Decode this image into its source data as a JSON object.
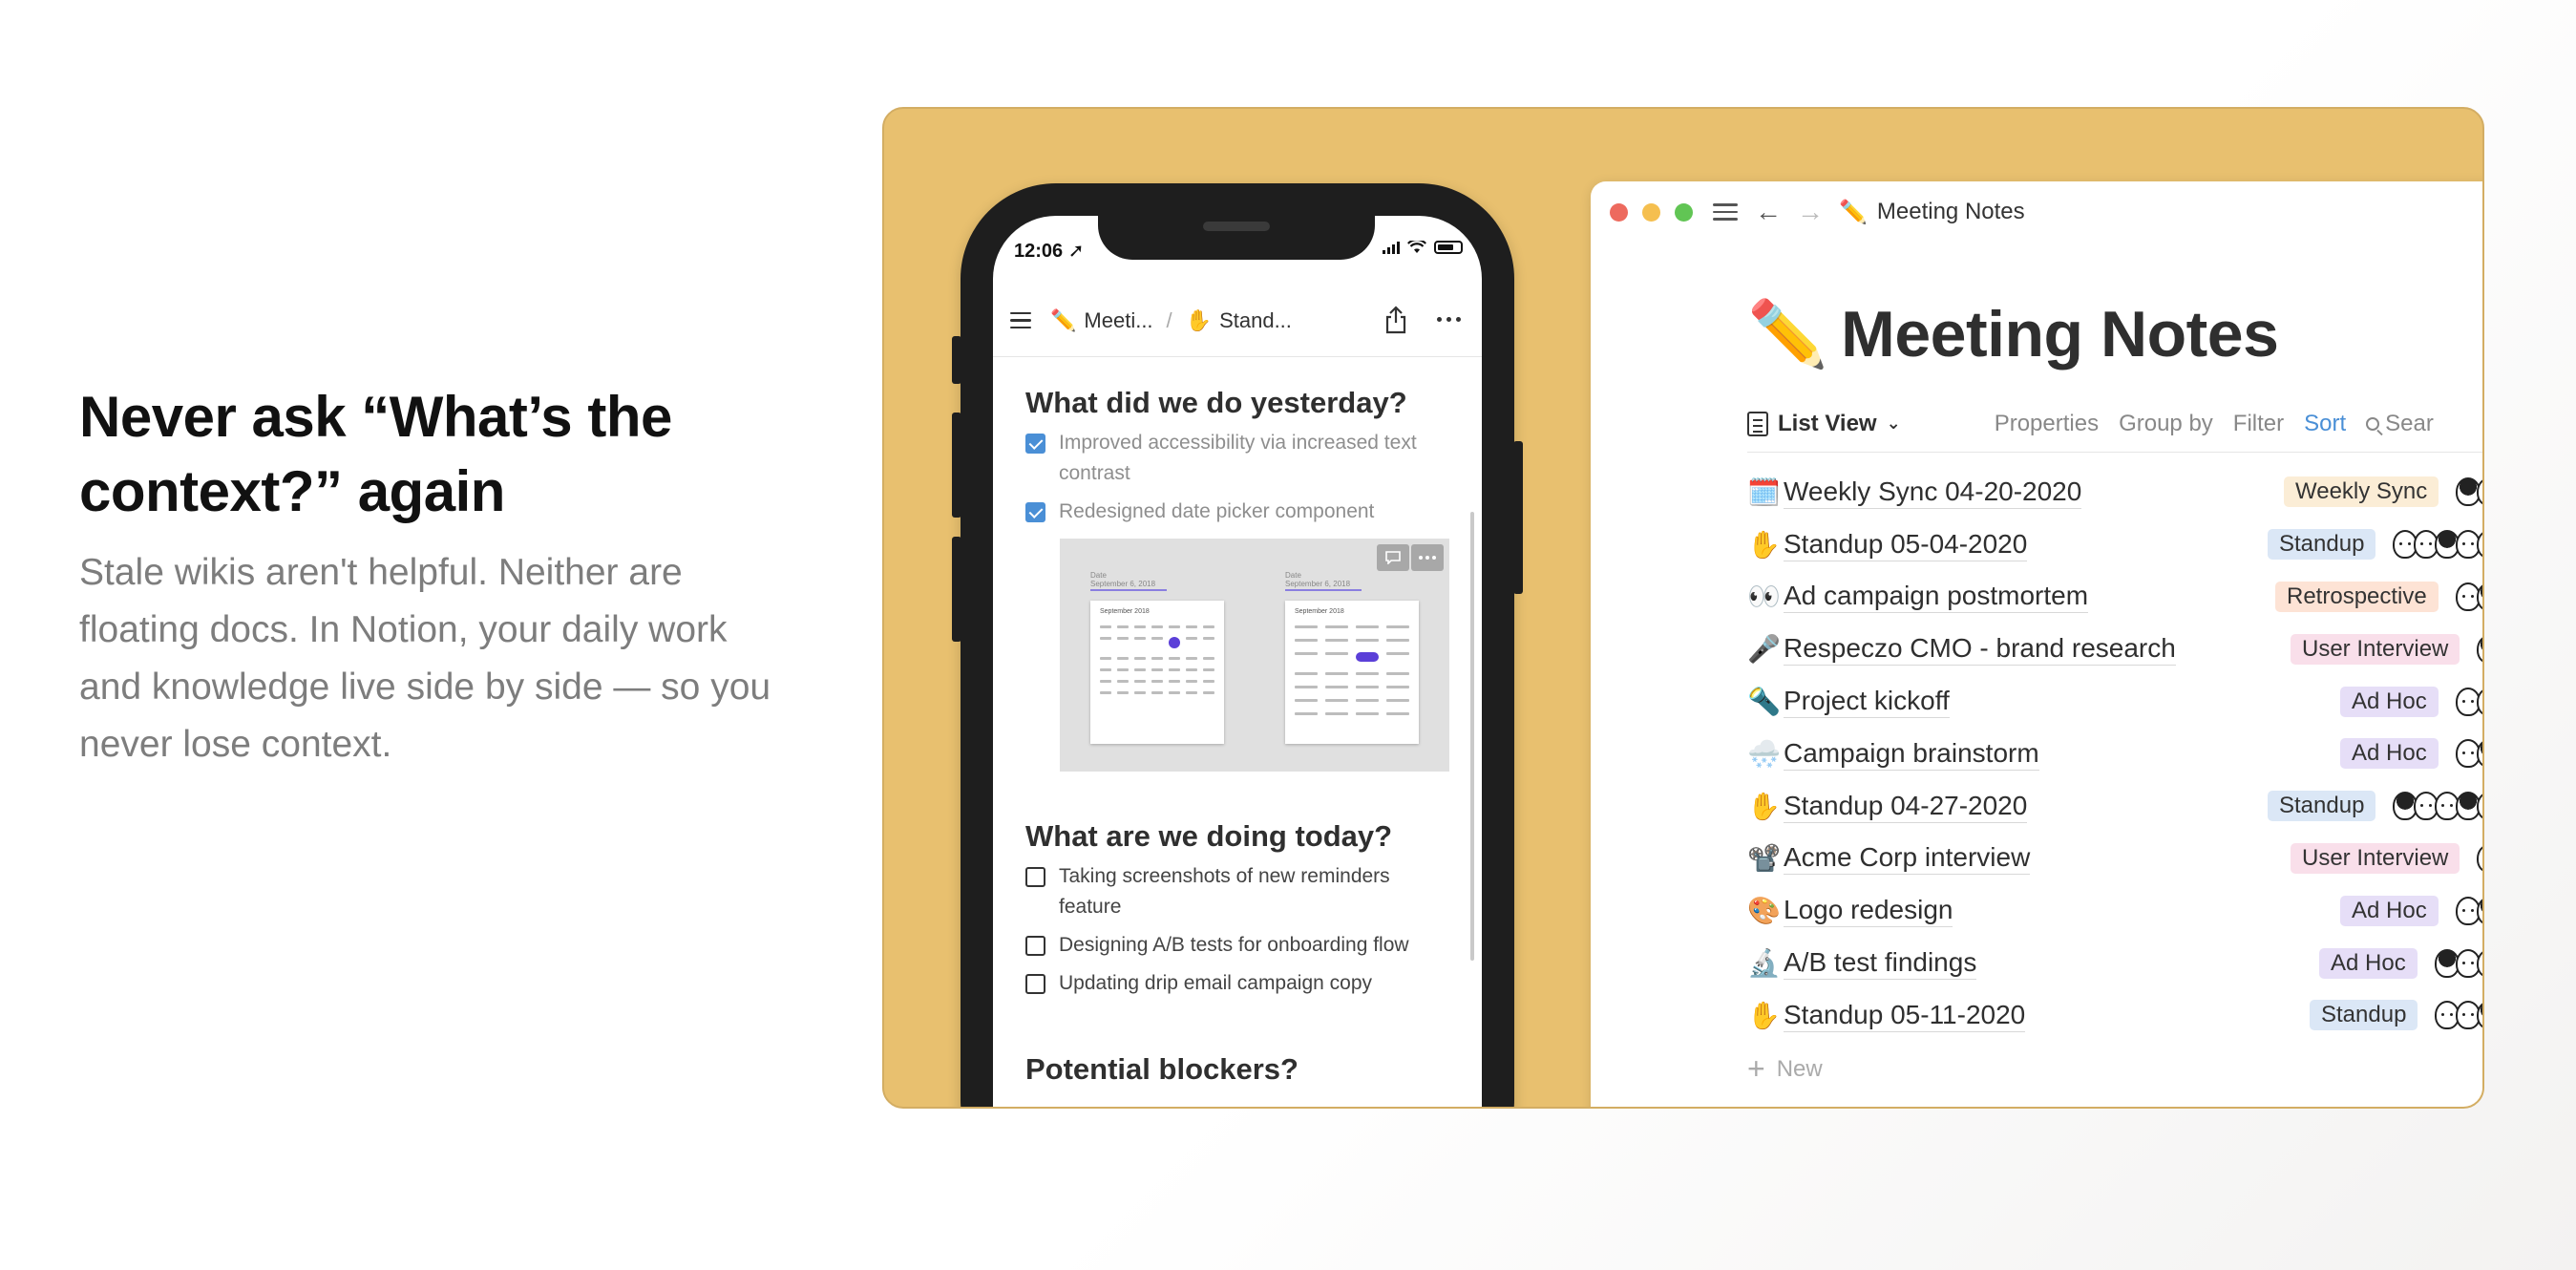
{
  "hero": {
    "heading": "Never ask “What’s the context?” again",
    "body": "Stale wikis aren't helpful. Neither are floating docs. In Notion, your daily work and knowledge live side by side — so you never lose context."
  },
  "colors": {
    "stage": "#e8c06f",
    "accent_blue": "#4a8fd6",
    "tag_weekly_sync": "#fbedd6",
    "tag_standup": "#dbe7f6",
    "tag_retrospective": "#fde3d5",
    "tag_user_interview": "#f9dfea",
    "tag_ad_hoc": "#e6def7"
  },
  "phone": {
    "time": "12:06",
    "breadcrumb": [
      {
        "icon": "✏️",
        "label": "Meeti..."
      },
      {
        "icon": "✋",
        "label": "Stand..."
      }
    ],
    "separator": "/",
    "sections": {
      "yesterday": {
        "heading": "What did we do yesterday?",
        "items": [
          {
            "text": "Improved accessibility via increased text contrast",
            "checked": true
          },
          {
            "text": "Redesigned date picker component",
            "checked": true
          }
        ]
      },
      "today": {
        "heading": "What are we doing today?",
        "items": [
          {
            "text": "Taking screenshots of new reminders feature",
            "checked": false
          },
          {
            "text": "Designing A/B tests for onboarding flow",
            "checked": false
          },
          {
            "text": "Updating drip email campaign copy",
            "checked": false
          }
        ]
      },
      "blockers": {
        "heading": "Potential blockers?"
      }
    },
    "embed": {
      "left_label": "Date",
      "left_value": "September 6, 2018",
      "right_label": "Date",
      "right_value": "September 6, 2018",
      "left_month": "September 2018",
      "right_month": "September 2018"
    }
  },
  "window": {
    "title_icon": "✏️",
    "title": "Meeting Notes",
    "page_title_icon": "✏️",
    "page_title": "Meeting Notes",
    "view": {
      "label": "List View",
      "properties": "Properties",
      "group_by": "Group by",
      "filter": "Filter",
      "sort": "Sort",
      "search": "Sear"
    },
    "rows": [
      {
        "icon": "🗓️",
        "name": "Weekly Sync 04-20-2020",
        "tag": "Weekly Sync",
        "faces": 2
      },
      {
        "icon": "✋",
        "name": "Standup 05-04-2020",
        "tag": "Standup",
        "faces": 5
      },
      {
        "icon": "👀",
        "name": "Ad campaign postmortem",
        "tag": "Retrospective",
        "faces": 2
      },
      {
        "icon": "🎤",
        "name": "Respeczo CMO - brand research",
        "tag": "User Interview",
        "faces": 1
      },
      {
        "icon": "🔦",
        "name": "Project kickoff",
        "tag": "Ad Hoc",
        "faces": 2
      },
      {
        "icon": "🌨️",
        "name": "Campaign brainstorm",
        "tag": "Ad Hoc",
        "faces": 2
      },
      {
        "icon": "✋",
        "name": "Standup 04-27-2020",
        "tag": "Standup",
        "faces": 5
      },
      {
        "icon": "📽️",
        "name": "Acme Corp interview",
        "tag": "User Interview",
        "faces": 1
      },
      {
        "icon": "🎨",
        "name": "Logo redesign",
        "tag": "Ad Hoc",
        "faces": 2
      },
      {
        "icon": "🔬",
        "name": "A/B test findings",
        "tag": "Ad Hoc",
        "faces": 3
      },
      {
        "icon": "✋",
        "name": "Standup 05-11-2020",
        "tag": "Standup",
        "faces": 3
      }
    ],
    "new_label": "New"
  }
}
